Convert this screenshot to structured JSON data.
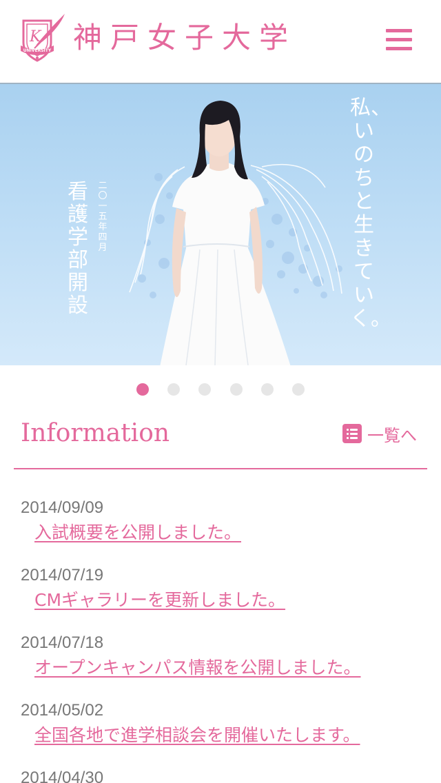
{
  "header": {
    "logo_alt": "神戸女子大学",
    "logo_emblem_text": "UNIVERSITY",
    "site_name": "神戸女子大学",
    "menu_icon": "hamburger-menu-icon",
    "brand_color": "#e4699c"
  },
  "hero": {
    "slogan": "私、いのちと生きていく。",
    "announcement": "看護学部 開設",
    "date": "二〇一五年 四月",
    "sky_color": "#bcdcf5"
  },
  "carousel": {
    "slide_count": 6,
    "active_index": 0
  },
  "information": {
    "title": "Information",
    "list_link_label": "一覧へ",
    "list_icon": "list-icon",
    "items": [
      {
        "date": "2014/09/09",
        "title": "入試概要を公開しました。"
      },
      {
        "date": "2014/07/19",
        "title": "CMギャラリーを更新しました。"
      },
      {
        "date": "2014/07/18",
        "title": "オープンキャンパス情報を公開しました。"
      },
      {
        "date": "2014/05/02",
        "title": "全国各地で進学相談会を開催いたします。"
      },
      {
        "date": "2014/04/30",
        "title": ""
      }
    ]
  }
}
